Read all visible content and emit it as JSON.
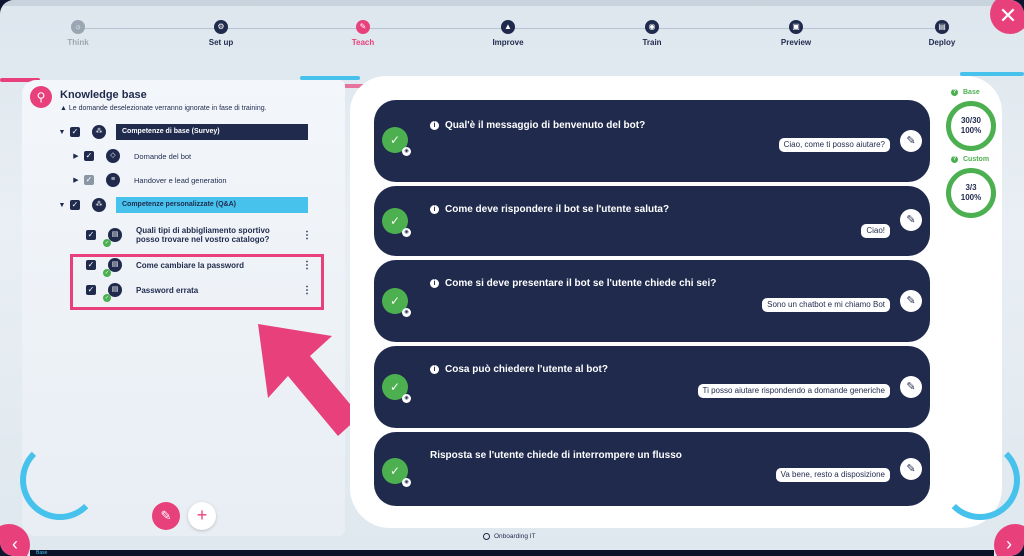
{
  "stepper": {
    "steps": [
      {
        "label": "Think",
        "icon": "bulb-icon",
        "glyph": "☼",
        "state": "done"
      },
      {
        "label": "Set up",
        "icon": "gear-icon",
        "glyph": "⚙",
        "state": "normal"
      },
      {
        "label": "Teach",
        "icon": "pencil-icon",
        "glyph": "✎",
        "state": "active"
      },
      {
        "label": "Improve",
        "icon": "ship-icon",
        "glyph": "▲",
        "state": "normal"
      },
      {
        "label": "Train",
        "icon": "globe-icon",
        "glyph": "◉",
        "state": "normal"
      },
      {
        "label": "Preview",
        "icon": "preview-icon",
        "glyph": "▣",
        "state": "normal"
      },
      {
        "label": "Deploy",
        "icon": "deploy-icon",
        "glyph": "▤",
        "state": "normal"
      }
    ]
  },
  "knowledge_base": {
    "title": "Knowledge base",
    "note": "▲ Le domande deselezionate verranno ignorate in fase di training.",
    "groups": {
      "base": {
        "label": "Competenze di base (Survey)"
      },
      "custom": {
        "label": "Competenze personalizzate (Q&A)"
      }
    },
    "items": {
      "domande": "Domande del bot",
      "handover": "Handover e lead generation",
      "abbigliamento_1": "Quali tipi di abbigliamento sportivo",
      "abbigliamento_2": "posso trovare nel vostro catalogo?",
      "password_change": "Come cambiare la password",
      "password_wrong": "Password errata"
    }
  },
  "cards": [
    {
      "question": "Qual'è il messaggio di benvenuto del bot?",
      "answer": "Ciao, come ti posso aiutare?",
      "info": true
    },
    {
      "question": "Come deve rispondere il bot se l'utente saluta?",
      "answer": "Ciao!",
      "info": true
    },
    {
      "question": "Come si deve presentare il bot se l'utente chiede chi sei?",
      "answer": "Sono un chatbot e mi chiamo Bot",
      "info": true
    },
    {
      "question": "Cosa può chiedere l'utente al bot?",
      "answer": "Ti posso aiutare rispondendo a domande generiche",
      "info": true
    },
    {
      "question": "Risposta se l'utente chiede di interrompere un flusso",
      "answer": "Va bene, resto a disposizione",
      "info": false
    }
  ],
  "stats": {
    "base": {
      "label": "Base",
      "count": "30/30",
      "percent": "100%"
    },
    "custom": {
      "label": "Custom",
      "count": "3/3",
      "percent": "100%"
    }
  },
  "footer": {
    "label": "Onboarding IT",
    "strip": "Base"
  },
  "colors": {
    "accent": "#e8407a",
    "navy": "#1f2a4d",
    "cyan": "#46c2ec",
    "green": "#4caf50"
  }
}
